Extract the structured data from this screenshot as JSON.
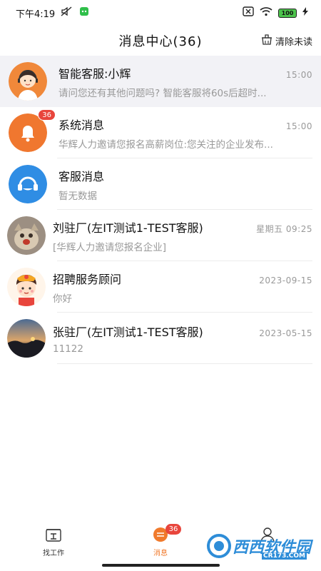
{
  "status_bar": {
    "time": "下午4:19",
    "battery": "100"
  },
  "header": {
    "title": "消息中心(36)",
    "clear_unread": "清除未读"
  },
  "messages": [
    {
      "name": "智能客服:小辉",
      "time": "15:00",
      "preview": "请问您还有其他问题吗? 智能客服将60s后超时...",
      "avatar": "customer-service-girl",
      "highlighted": true
    },
    {
      "name": "系统消息",
      "time": "15:00",
      "preview": "华辉人力邀请您报名高薪岗位:您关注的企业发布...",
      "avatar": "bell-icon",
      "badge": "36"
    },
    {
      "name": "客服消息",
      "time": "",
      "preview": "暂无数据",
      "avatar": "headset-icon"
    },
    {
      "name": "刘驻厂(左IT测试1-TEST客服)",
      "time": "星期五 09:25",
      "preview": "[华辉人力邀请您报名企业]",
      "avatar": "photo-cat"
    },
    {
      "name": "招聘服务顾问",
      "time": "2023-09-15",
      "preview": "你好",
      "avatar": "cartoon-girl"
    },
    {
      "name": "张驻厂(左IT测试1-TEST客服)",
      "time": "2023-05-15",
      "preview": "11122",
      "avatar": "photo-sunset"
    }
  ],
  "tabbar": {
    "find_job": "找工作",
    "messages": "消息",
    "messages_badge": "36"
  },
  "watermark": {
    "text": "西西软件园",
    "sub": "CR173.COM"
  },
  "colors": {
    "accent": "#f07a2c",
    "badge": "#e8453c",
    "blue": "#2f8de4"
  }
}
